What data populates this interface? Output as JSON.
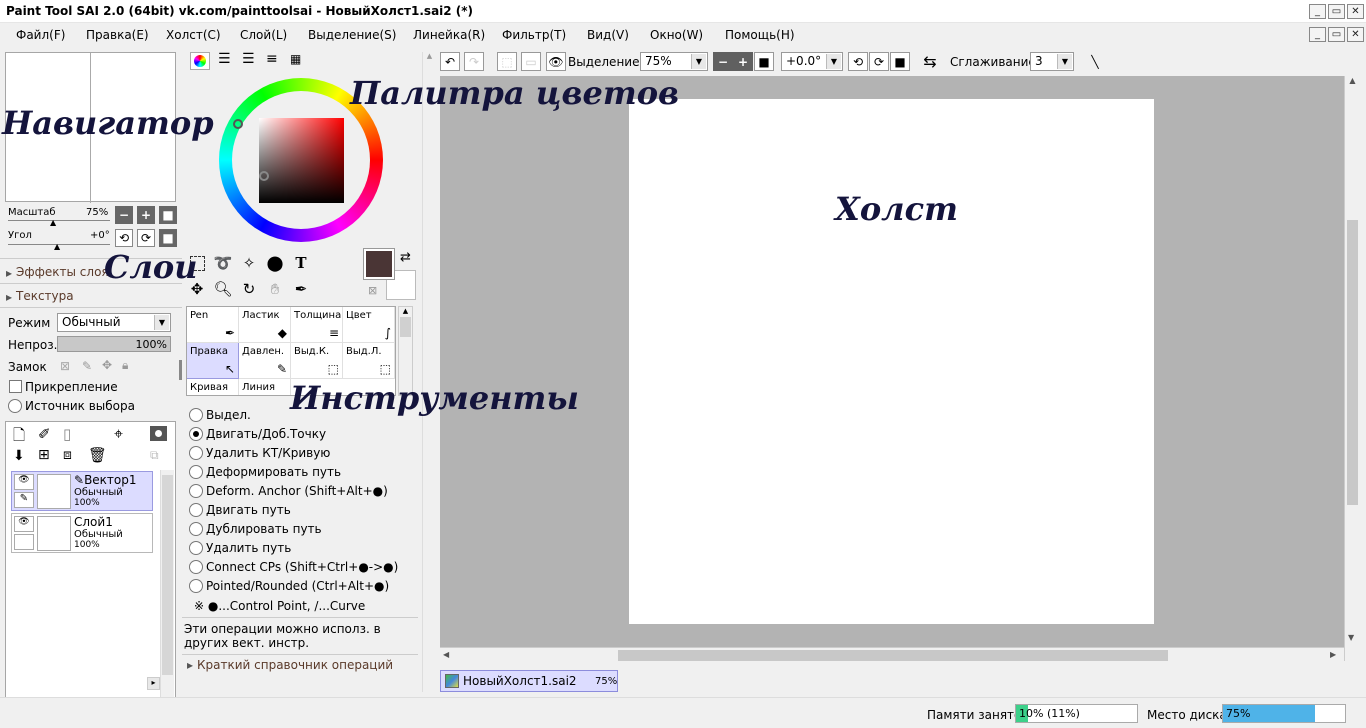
{
  "window": {
    "title": "Paint Tool SAI 2.0 (64bit) vk.com/painttoolsai - НовыйХолст1.sai2 (*)"
  },
  "menu": [
    "Файл(F)",
    "Правка(E)",
    "Холст(C)",
    "Слой(L)",
    "Выделение(S)",
    "Линейка(R)",
    "Фильтр(T)",
    "Вид(V)",
    "Окно(W)",
    "Помощь(H)"
  ],
  "navigator": {
    "zoom_label": "Масштаб",
    "zoom_value": "75%",
    "angle_label": "Угол",
    "angle_value": "+0°"
  },
  "layer_props": {
    "effects": "Эффекты слоя",
    "texture": "Текстура",
    "mode_label": "Режим",
    "mode_value": "Обычный",
    "opacity_label": "Непроз.",
    "opacity_value": "100%",
    "lock_label": "Замок",
    "clip": "Прикрепление",
    "selection_source": "Источник выбора"
  },
  "layers": [
    {
      "name": "Вектор1",
      "mode": "Обычный",
      "opacity": "100%"
    },
    {
      "name": "Слой1",
      "mode": "Обычный",
      "opacity": "100%"
    }
  ],
  "brushes": [
    {
      "name": "Pen",
      "icon": "pen-icon"
    },
    {
      "name": "Ластик",
      "icon": "eraser-icon"
    },
    {
      "name": "Толщина",
      "icon": "thickness-icon"
    },
    {
      "name": "Цвет",
      "icon": "color-icon"
    },
    {
      "name": "Правка",
      "icon": "edit-cursor-icon"
    },
    {
      "name": "Давлен.",
      "icon": "pressure-icon"
    },
    {
      "name": "Выд.К.",
      "icon": "select-curve-icon"
    },
    {
      "name": "Выд.Л.",
      "icon": "select-line-icon"
    },
    {
      "name": "Кривая",
      "icon": "curve-icon"
    },
    {
      "name": "Линия",
      "icon": "line-icon"
    }
  ],
  "edit_options": [
    {
      "label": "Выдел.",
      "checked": false
    },
    {
      "label": "Двигать/Доб.Точку",
      "checked": true
    },
    {
      "label": "Удалить КТ/Кривую",
      "checked": false
    },
    {
      "label": "Деформировать путь",
      "checked": false
    },
    {
      "label": "Deform. Anchor (Shift+Alt+●)",
      "checked": false
    },
    {
      "label": "Двигать путь",
      "checked": false
    },
    {
      "label": "Дублировать путь",
      "checked": false
    },
    {
      "label": "Удалить путь",
      "checked": false
    },
    {
      "label": "Connect CPs (Shift+Ctrl+●->●)",
      "checked": false
    },
    {
      "label": "Pointed/Rounded (Ctrl+Alt+●)",
      "checked": false
    }
  ],
  "edit_note": "※ ●...Control Point, /...Curve",
  "edit_hint": "Эти операции можно исполз. в других вект. инстр.",
  "quick_ref": "Краткий справочник операций",
  "toolbar": {
    "selection": "Выделение",
    "zoom": "75%",
    "angle": "+0.0°",
    "smoothing_label": "Сглаживание",
    "smoothing_value": "3"
  },
  "doc_tab": {
    "name": "НовыйХолст1.sai2",
    "zoom": "75%"
  },
  "status": {
    "memory_label": "Памяти занято",
    "memory_value": "10% (11%)",
    "memory_fraction": 0.1,
    "disk_label": "Место диска",
    "disk_value": "75%",
    "disk_fraction": 0.75
  },
  "annotations": {
    "navigator": "Навигатор",
    "palette": "Палитра цветов",
    "layers": "Слои",
    "tools": "Инструменты",
    "canvas": "Холст"
  },
  "colors": {
    "primary": "#4a3535",
    "secondary": "#ffffff",
    "progress": "#4fb3e8",
    "memory": "#3dd08a"
  }
}
